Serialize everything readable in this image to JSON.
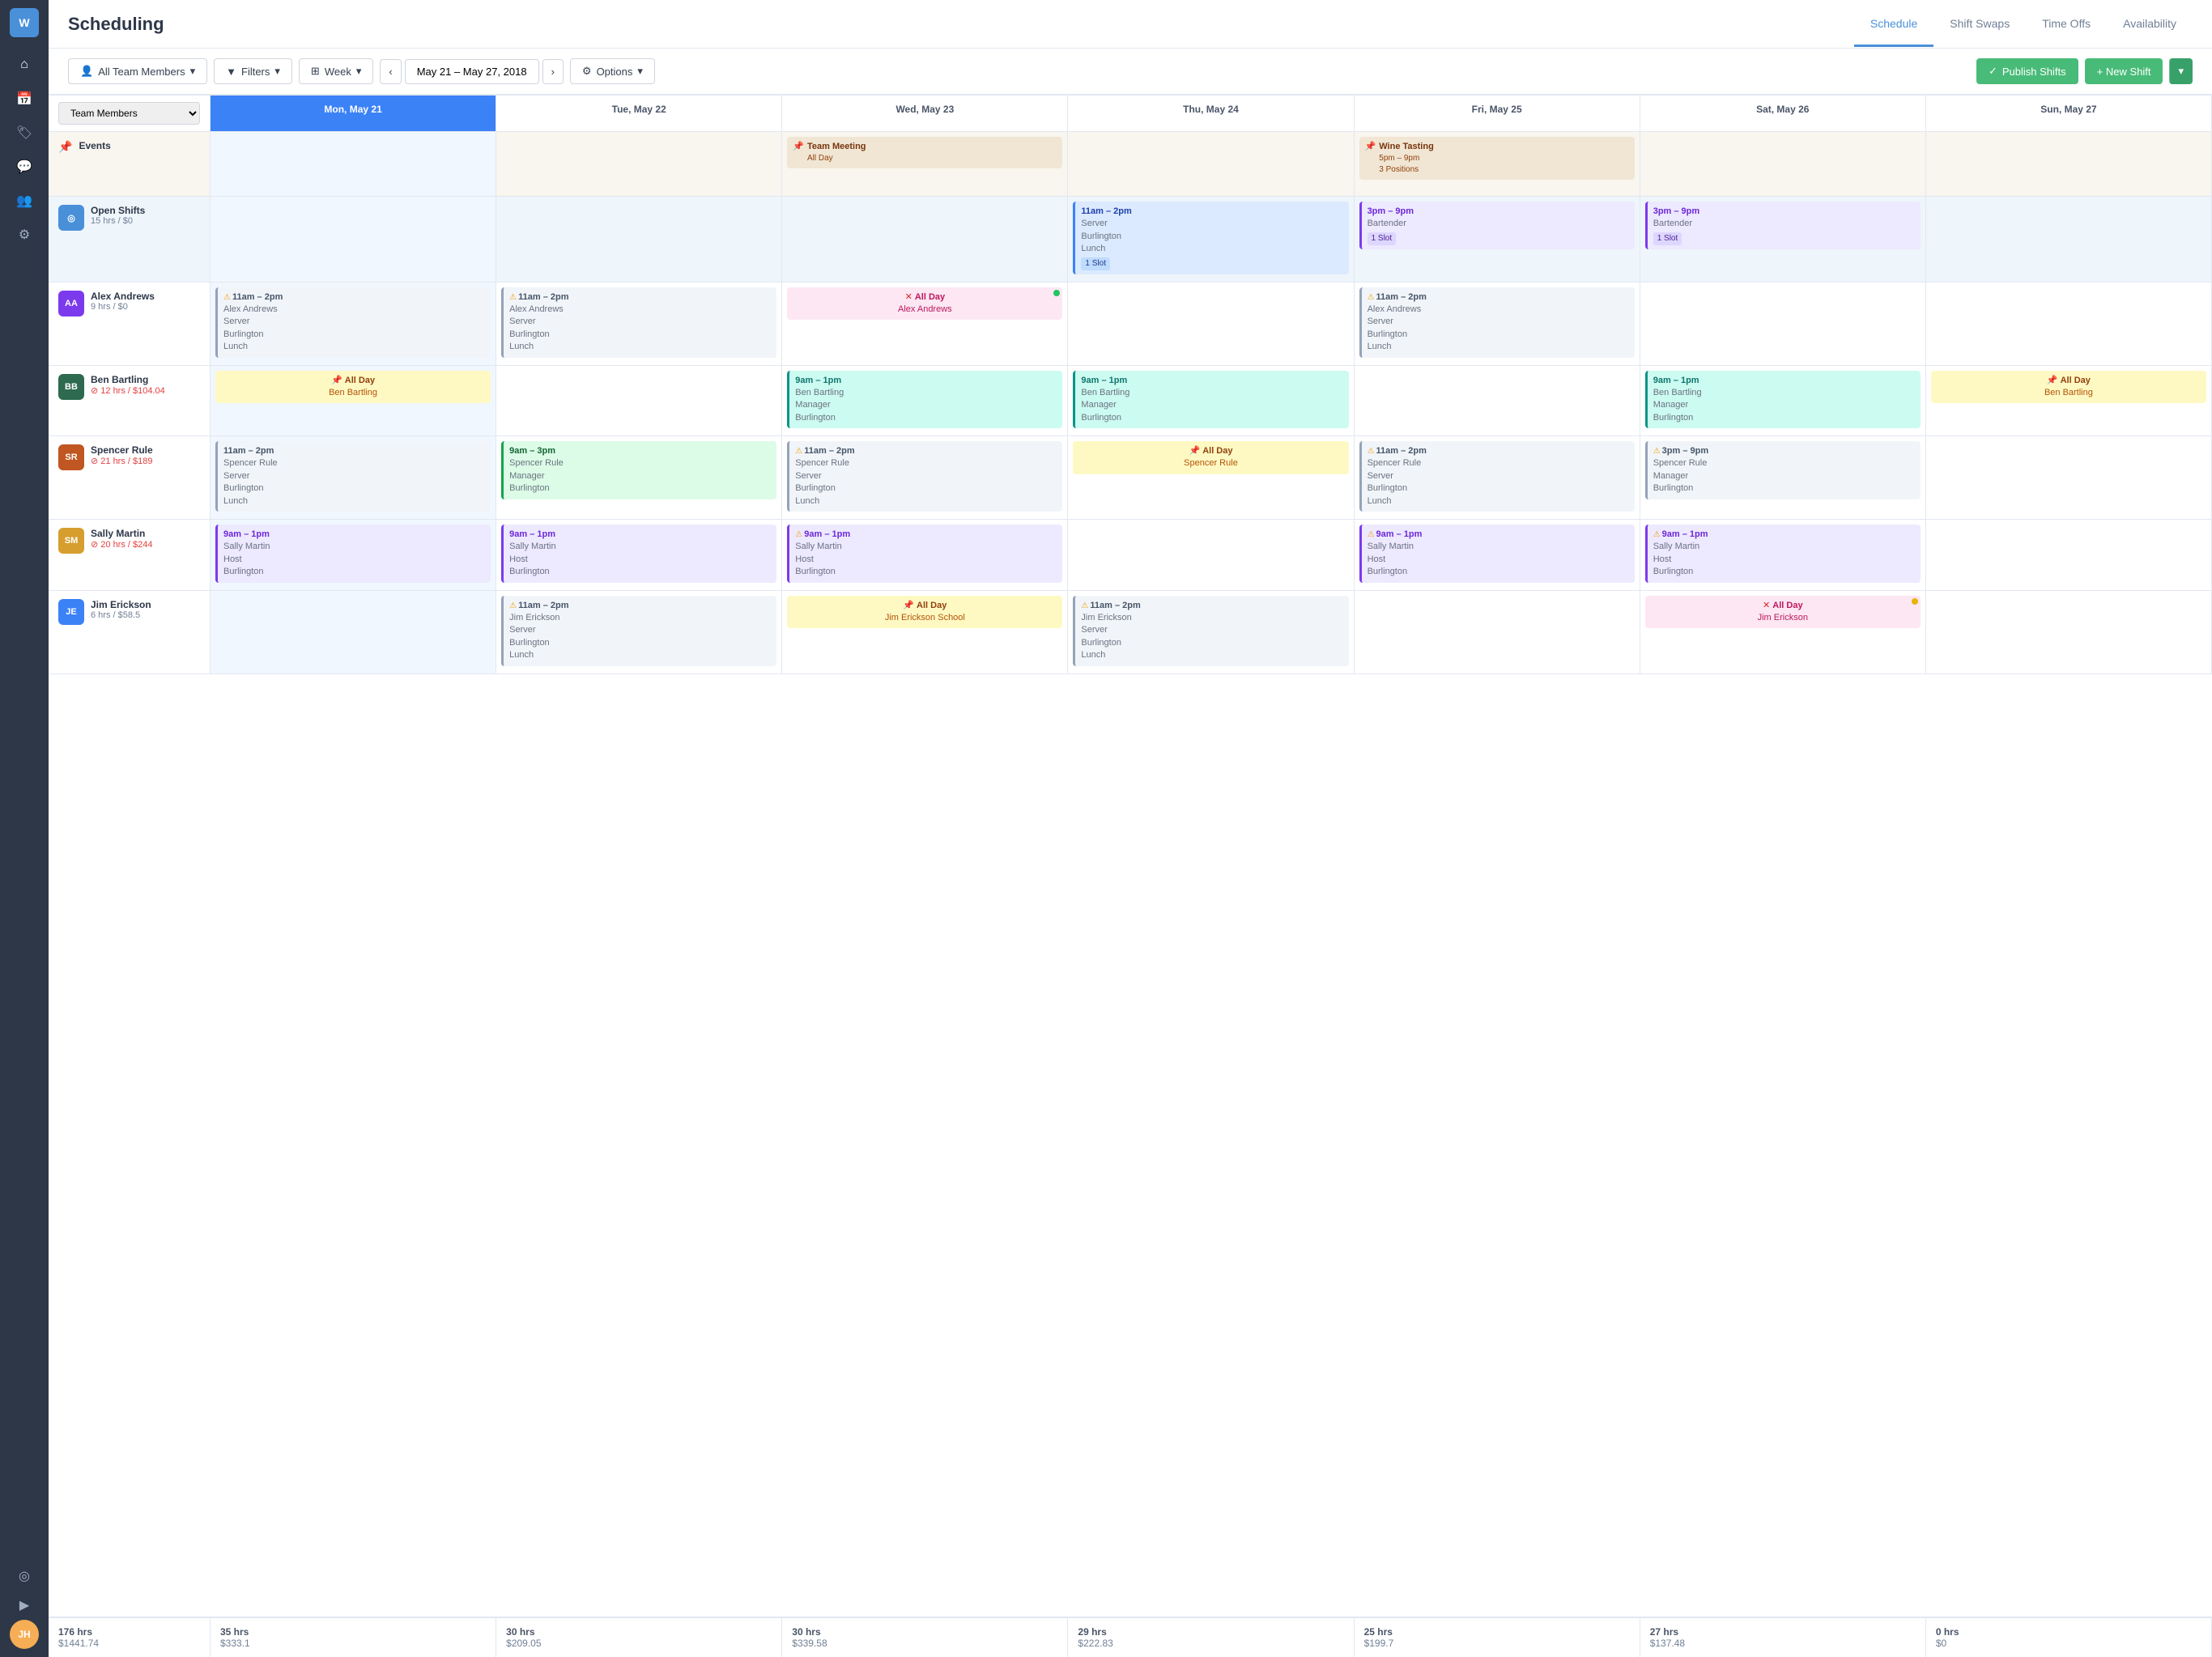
{
  "app": {
    "logo": "W",
    "title": "Scheduling"
  },
  "topNav": {
    "items": [
      {
        "id": "schedule",
        "label": "Schedule",
        "active": true
      },
      {
        "id": "shift-swaps",
        "label": "Shift Swaps",
        "active": false
      },
      {
        "id": "time-offs",
        "label": "Time Offs",
        "active": false
      },
      {
        "id": "availability",
        "label": "Availability",
        "active": false
      }
    ]
  },
  "toolbar": {
    "team_members_label": "All Team Members",
    "filters_label": "Filters",
    "week_label": "Week",
    "date_range": "May 21 – May 27, 2018",
    "options_label": "Options",
    "publish_label": "Publish Shifts",
    "new_shift_label": "+ New Shift"
  },
  "calendar": {
    "row_label_placeholder": "Team Members",
    "days": [
      {
        "label": "Mon, May 21",
        "today": true
      },
      {
        "label": "Tue, May 22",
        "today": false
      },
      {
        "label": "Wed, May 23",
        "today": false
      },
      {
        "label": "Thu, May 24",
        "today": false
      },
      {
        "label": "Fri, May 25",
        "today": false
      },
      {
        "label": "Sat, May 26",
        "today": false
      },
      {
        "label": "Sun, May 27",
        "today": false
      }
    ],
    "rows": [
      {
        "id": "events",
        "type": "events",
        "label": "Events",
        "cells": [
          {
            "day": 0,
            "shifts": []
          },
          {
            "day": 1,
            "shifts": []
          },
          {
            "day": 2,
            "shifts": [
              {
                "type": "event",
                "allday": true,
                "pin": true,
                "title": "Team Meeting",
                "subtitle": "All Day"
              }
            ]
          },
          {
            "day": 3,
            "shifts": []
          },
          {
            "day": 4,
            "shifts": [
              {
                "type": "event",
                "pin": true,
                "title": "Wine Tasting",
                "time": "5pm – 9pm",
                "subtitle": "3 Positions"
              }
            ]
          },
          {
            "day": 5,
            "shifts": []
          },
          {
            "day": 6,
            "shifts": []
          }
        ]
      },
      {
        "id": "open-shifts",
        "type": "open-shifts",
        "label": "Open Shifts",
        "meta": "15 hrs / $0",
        "cells": [
          {
            "day": 0,
            "shifts": []
          },
          {
            "day": 1,
            "shifts": []
          },
          {
            "day": 2,
            "shifts": []
          },
          {
            "day": 3,
            "shifts": [
              {
                "type": "blue",
                "time": "11am – 2pm",
                "role": "Server",
                "location": "Burlington",
                "sublocation": "Lunch",
                "slot": "1 Slot"
              }
            ]
          },
          {
            "day": 4,
            "shifts": [
              {
                "type": "purple",
                "time": "3pm – 9pm",
                "role": "Bartender",
                "slot": "1 Slot",
                "slotColor": "purple"
              }
            ]
          },
          {
            "day": 5,
            "shifts": [
              {
                "type": "purple",
                "time": "3pm – 9pm",
                "role": "Bartender",
                "slot": "1 Slot",
                "slotColor": "purple"
              }
            ]
          },
          {
            "day": 6,
            "shifts": []
          }
        ]
      },
      {
        "id": "alex-andrews",
        "type": "person",
        "avatarColor": "#7c3aed",
        "avatarText": "AA",
        "label": "Alex Andrews",
        "meta": "9 hrs / $0",
        "metaType": "normal",
        "cells": [
          {
            "day": 0,
            "shifts": [
              {
                "type": "gray",
                "warn": true,
                "time": "11am – 2pm",
                "name": "Alex Andrews",
                "role": "Server",
                "location": "Burlington",
                "sublocation": "Lunch"
              }
            ]
          },
          {
            "day": 1,
            "shifts": [
              {
                "type": "gray",
                "warn": true,
                "time": "11am – 2pm",
                "name": "Alex Andrews",
                "role": "Server",
                "location": "Burlington",
                "sublocation": "Lunch"
              }
            ]
          },
          {
            "day": 2,
            "shifts": [
              {
                "type": "allday-pink",
                "error": true,
                "allday": true,
                "name": "Alex Andrews",
                "dot": "green"
              }
            ]
          },
          {
            "day": 3,
            "shifts": []
          },
          {
            "day": 4,
            "shifts": [
              {
                "type": "gray",
                "warn": true,
                "time": "11am – 2pm",
                "name": "Alex Andrews",
                "role": "Server",
                "location": "Burlington",
                "sublocation": "Lunch"
              }
            ]
          },
          {
            "day": 5,
            "shifts": []
          },
          {
            "day": 6,
            "shifts": []
          }
        ]
      },
      {
        "id": "ben-bartling",
        "type": "person",
        "avatarColor": "#2d6a4f",
        "avatarText": "BB",
        "label": "Ben Bartling",
        "meta": "12 hrs / $104.04",
        "metaType": "red",
        "cells": [
          {
            "day": 0,
            "shifts": [
              {
                "type": "allday-yellow",
                "pin": true,
                "allday": true,
                "name": "Ben Bartling"
              }
            ]
          },
          {
            "day": 1,
            "shifts": []
          },
          {
            "day": 2,
            "shifts": [
              {
                "type": "teal",
                "time": "9am – 1pm",
                "name": "Ben Bartling",
                "role": "Manager",
                "location": "Burlington"
              }
            ]
          },
          {
            "day": 3,
            "shifts": [
              {
                "type": "teal",
                "time": "9am – 1pm",
                "name": "Ben Bartling",
                "role": "Manager",
                "location": "Burlington"
              }
            ]
          },
          {
            "day": 4,
            "shifts": []
          },
          {
            "day": 5,
            "shifts": [
              {
                "type": "teal",
                "time": "9am – 1pm",
                "name": "Ben Bartling",
                "role": "Manager",
                "location": "Burlington"
              }
            ]
          },
          {
            "day": 6,
            "shifts": [
              {
                "type": "allday-yellow",
                "pin": true,
                "allday": true,
                "name": "Ben Bartling"
              }
            ]
          }
        ]
      },
      {
        "id": "spencer-rule",
        "type": "person",
        "avatarColor": "#c05621",
        "avatarText": "SR",
        "label": "Spencer Rule",
        "meta": "21 hrs / $189",
        "metaType": "red",
        "cells": [
          {
            "day": 0,
            "shifts": [
              {
                "type": "gray",
                "time": "11am – 2pm",
                "name": "Spencer Rule",
                "role": "Server",
                "location": "Burlington",
                "sublocation": "Lunch"
              }
            ]
          },
          {
            "day": 1,
            "shifts": [
              {
                "type": "green",
                "time": "9am – 3pm",
                "name": "Spencer Rule",
                "role": "Manager",
                "location": "Burlington"
              }
            ]
          },
          {
            "day": 2,
            "shifts": [
              {
                "type": "gray",
                "warn": true,
                "time": "11am – 2pm",
                "name": "Spencer Rule",
                "role": "Server",
                "location": "Burlington",
                "sublocation": "Lunch"
              }
            ]
          },
          {
            "day": 3,
            "shifts": [
              {
                "type": "allday-yellow",
                "pin": true,
                "allday": true,
                "name": "Spencer Rule"
              }
            ]
          },
          {
            "day": 4,
            "shifts": [
              {
                "type": "gray",
                "warn": true,
                "time": "11am – 2pm",
                "name": "Spencer Rule",
                "role": "Server",
                "location": "Burlington",
                "sublocation": "Lunch"
              }
            ]
          },
          {
            "day": 5,
            "shifts": [
              {
                "type": "gray",
                "warn": true,
                "time": "3pm – 9pm",
                "name": "Spencer Rule",
                "role": "Manager",
                "location": "Burlington"
              }
            ]
          },
          {
            "day": 6,
            "shifts": []
          }
        ]
      },
      {
        "id": "sally-martin",
        "type": "person",
        "avatarColor": "#d69e2e",
        "avatarText": "SM",
        "label": "Sally Martin",
        "meta": "20 hrs / $244",
        "metaType": "red",
        "cells": [
          {
            "day": 0,
            "shifts": [
              {
                "type": "purple",
                "time": "9am – 1pm",
                "name": "Sally Martin",
                "role": "Host",
                "location": "Burlington"
              }
            ]
          },
          {
            "day": 1,
            "shifts": [
              {
                "type": "purple",
                "time": "9am – 1pm",
                "name": "Sally Martin",
                "role": "Host",
                "location": "Burlington"
              }
            ]
          },
          {
            "day": 2,
            "shifts": [
              {
                "type": "purple",
                "warn": true,
                "time": "9am – 1pm",
                "name": "Sally Martin",
                "role": "Host",
                "location": "Burlington"
              }
            ]
          },
          {
            "day": 3,
            "shifts": []
          },
          {
            "day": 4,
            "shifts": [
              {
                "type": "purple",
                "warn": true,
                "time": "9am – 1pm",
                "name": "Sally Martin",
                "role": "Host",
                "location": "Burlington"
              }
            ]
          },
          {
            "day": 5,
            "shifts": [
              {
                "type": "purple",
                "warn": true,
                "time": "9am – 1pm",
                "name": "Sally Martin",
                "role": "Host",
                "location": "Burlington"
              }
            ]
          },
          {
            "day": 6,
            "shifts": []
          }
        ]
      },
      {
        "id": "jim-erickson",
        "type": "person",
        "avatarColor": "#3b82f6",
        "avatarText": "JE",
        "label": "Jim Erickson",
        "meta": "6 hrs / $58.5",
        "metaType": "normal",
        "cells": [
          {
            "day": 0,
            "shifts": []
          },
          {
            "day": 1,
            "shifts": [
              {
                "type": "gray",
                "warn": true,
                "time": "11am – 2pm",
                "name": "Jim Erickson",
                "role": "Server",
                "location": "Burlington",
                "sublocation": "Lunch"
              }
            ]
          },
          {
            "day": 2,
            "shifts": [
              {
                "type": "allday-yellow",
                "pin": true,
                "allday": true,
                "name": "Jim Erickson School"
              }
            ]
          },
          {
            "day": 3,
            "shifts": [
              {
                "type": "gray",
                "warn": true,
                "time": "11am – 2pm",
                "name": "Jim Erickson",
                "role": "Server",
                "location": "Burlington",
                "sublocation": "Lunch"
              }
            ]
          },
          {
            "day": 4,
            "shifts": []
          },
          {
            "day": 5,
            "shifts": [
              {
                "type": "allday-pink",
                "error": true,
                "allday": true,
                "name": "Jim Erickson",
                "dot": "yellow"
              }
            ]
          },
          {
            "day": 6,
            "shifts": []
          }
        ]
      }
    ],
    "totals": [
      {
        "label": "176 hrs\n$1441.74"
      },
      {
        "hrs": "35 hrs",
        "cost": "$333.1"
      },
      {
        "hrs": "30 hrs",
        "cost": "$209.05"
      },
      {
        "hrs": "30 hrs",
        "cost": "$339.58"
      },
      {
        "hrs": "29 hrs",
        "cost": "$222.83"
      },
      {
        "hrs": "25 hrs",
        "cost": "$199.7"
      },
      {
        "hrs": "27 hrs",
        "cost": "$137.48"
      },
      {
        "hrs": "0 hrs",
        "cost": "$0"
      }
    ]
  },
  "sidebar": {
    "logo": "W",
    "userInitials": "JH",
    "items": [
      {
        "icon": "⌂",
        "label": "Home"
      },
      {
        "icon": "📅",
        "label": "Schedule",
        "active": true
      },
      {
        "icon": "🏷",
        "label": "Tags"
      },
      {
        "icon": "💬",
        "label": "Messages"
      },
      {
        "icon": "👥",
        "label": "Team"
      },
      {
        "icon": "⚙",
        "label": "Settings"
      },
      {
        "icon": "◎",
        "label": "Activity"
      },
      {
        "icon": "▶",
        "label": "Play"
      }
    ]
  }
}
